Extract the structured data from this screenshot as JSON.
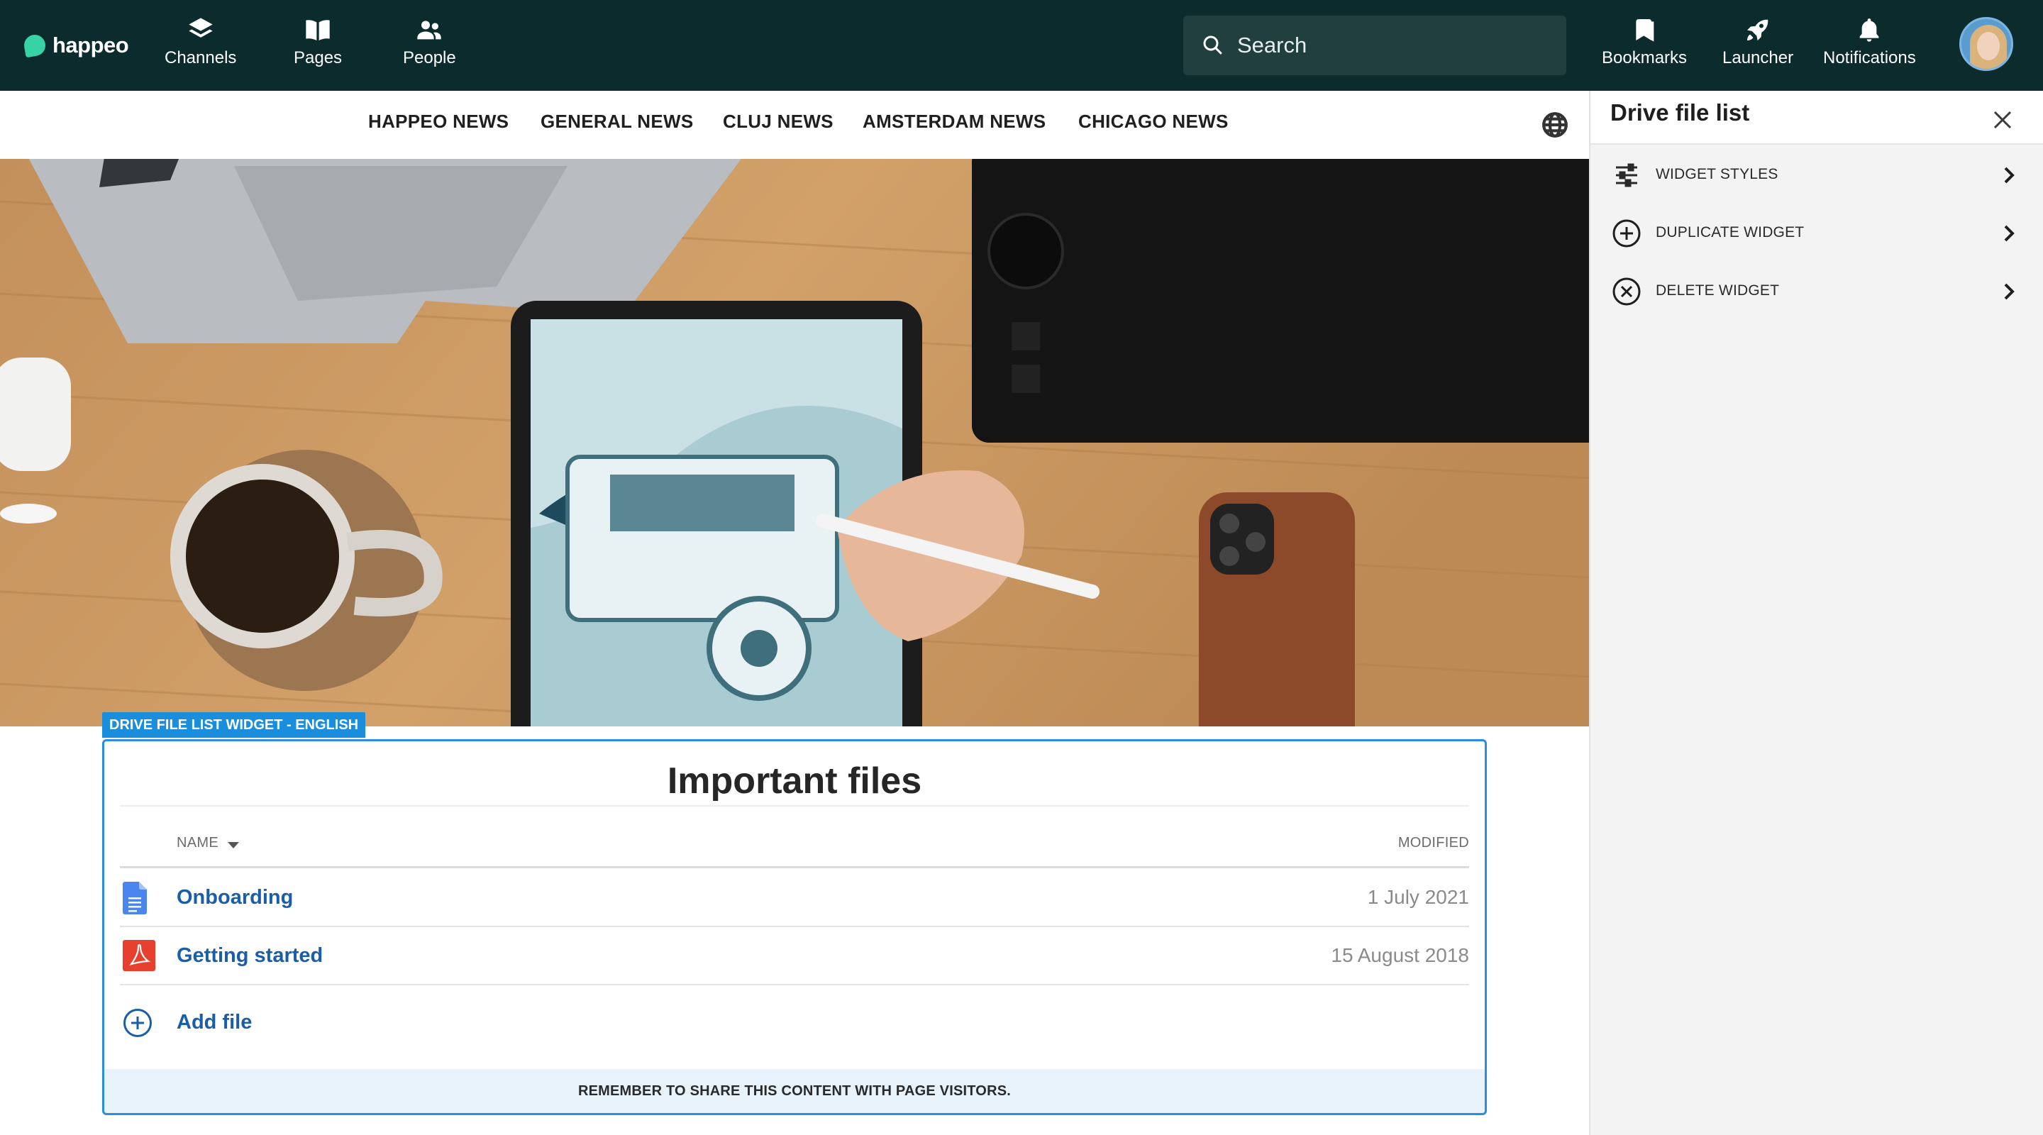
{
  "app": {
    "brand": "happeo",
    "brand_color": "#37d3a6",
    "topbar_color": "#0b2b2c"
  },
  "topnav": {
    "channels": {
      "label": "Channels",
      "icon": "channels-icon"
    },
    "pages": {
      "label": "Pages",
      "icon": "book-icon"
    },
    "people": {
      "label": "People",
      "icon": "people-icon"
    },
    "search_placeholder": "Search",
    "bookmarks": {
      "label": "Bookmarks",
      "icon": "bookmark-icon"
    },
    "launcher": {
      "label": "Launcher",
      "icon": "rocket-icon"
    },
    "notifications": {
      "label": "Notifications",
      "icon": "bell-icon"
    }
  },
  "news_tabs": [
    "HAPPEO NEWS",
    "GENERAL NEWS",
    "CLUJ NEWS",
    "AMSTERDAM NEWS",
    "CHICAGO NEWS"
  ],
  "widget": {
    "tag": "DRIVE FILE LIST WIDGET - ENGLISH",
    "title": "Important files",
    "col_name": "NAME",
    "col_modified": "MODIFIED",
    "files": [
      {
        "name": "Onboarding",
        "modified": "1 July 2021",
        "type": "google-doc"
      },
      {
        "name": "Getting started",
        "modified": "15 August 2018",
        "type": "pdf"
      }
    ],
    "add_label": "Add file",
    "footer_note": "REMEMBER TO SHARE THIS CONTENT WITH PAGE VISITORS.",
    "accent": "#1a8ddc"
  },
  "panel": {
    "title": "Drive file list",
    "items": [
      {
        "label": "WIDGET STYLES",
        "icon": "sliders-icon"
      },
      {
        "label": "DUPLICATE WIDGET",
        "icon": "plus-circle-icon"
      },
      {
        "label": "DELETE WIDGET",
        "icon": "x-circle-icon"
      }
    ]
  }
}
